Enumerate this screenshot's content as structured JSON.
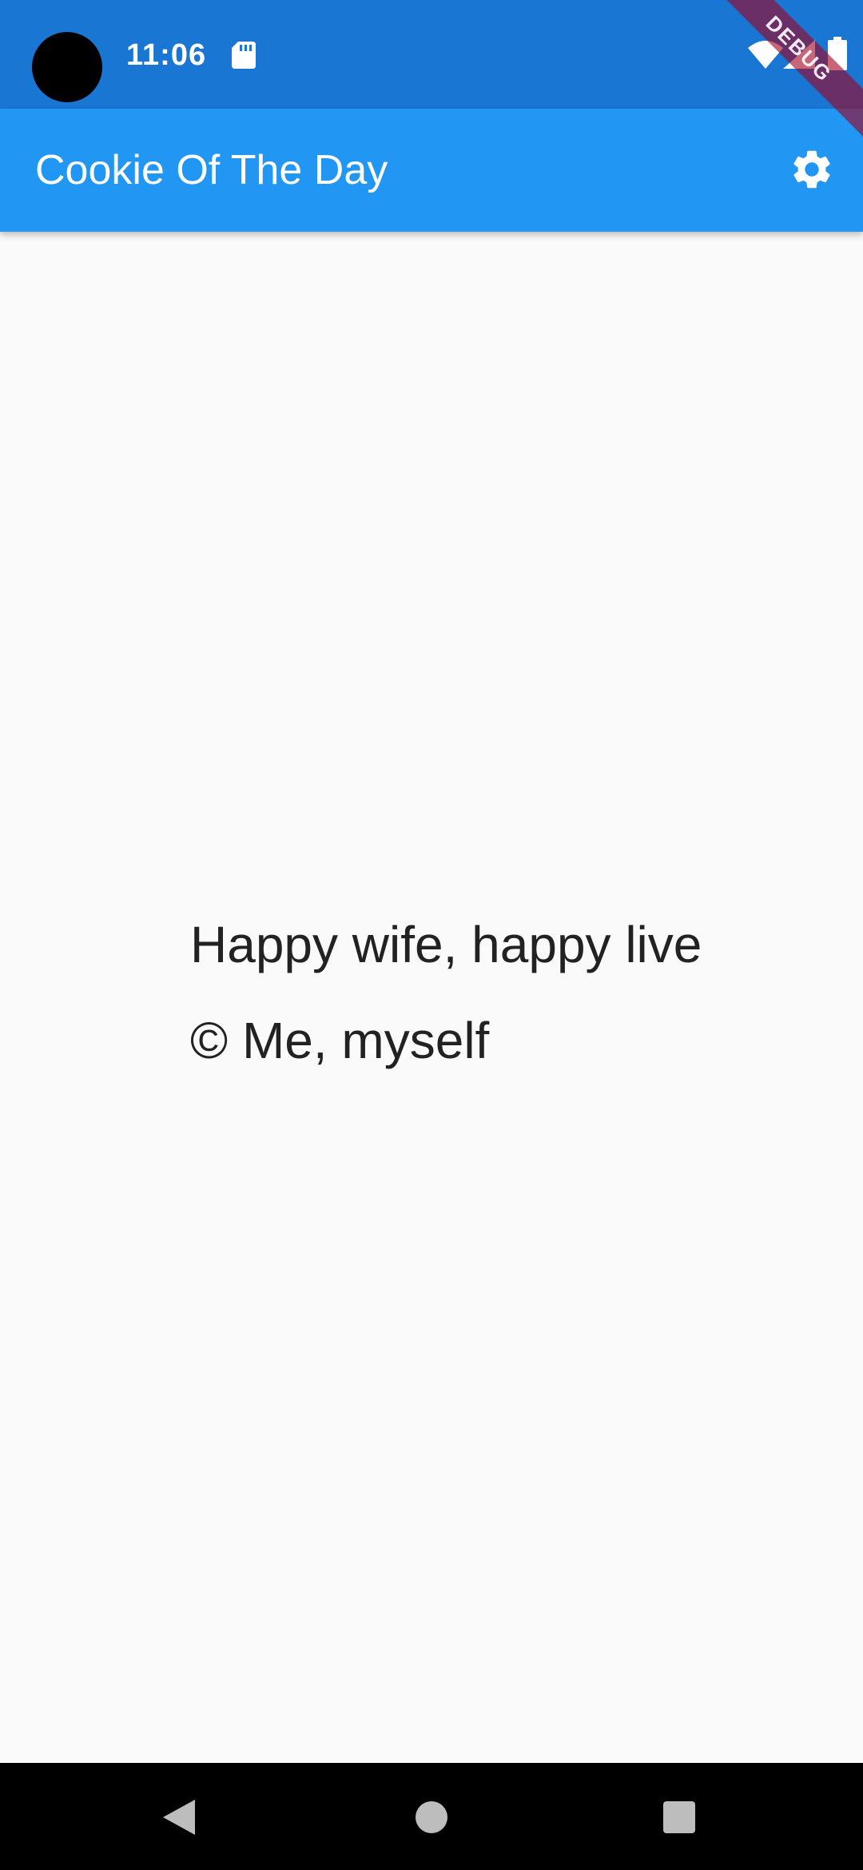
{
  "status_bar": {
    "time": "11:06",
    "icons": [
      "sd-card-icon",
      "wifi-icon",
      "signal-icon",
      "battery-icon"
    ],
    "background": "#1976d2"
  },
  "debug_banner": {
    "label": "DEBUG"
  },
  "app_bar": {
    "title": "Cookie Of The Day",
    "action_icon": "gear-icon",
    "background": "#2196f3"
  },
  "quote": {
    "text": "Happy wife, happy live",
    "author": "© Me, myself"
  },
  "nav_bar": {
    "buttons": [
      "back",
      "home",
      "recents"
    ]
  }
}
